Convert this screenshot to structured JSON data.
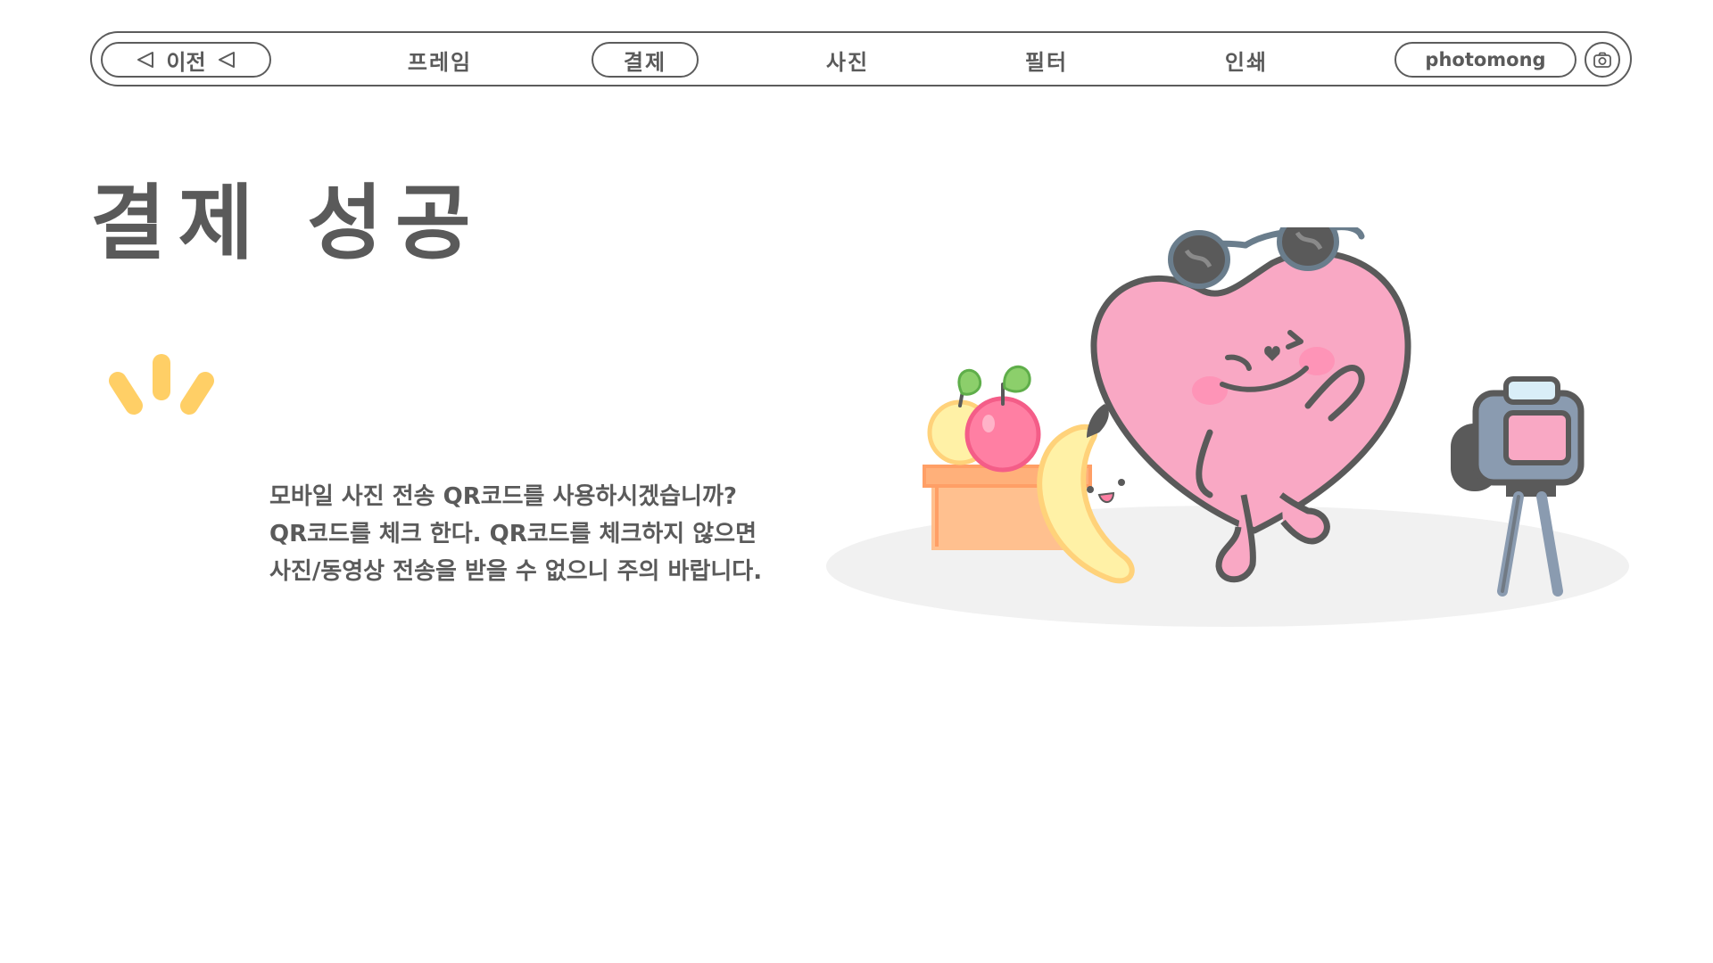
{
  "nav": {
    "back_label": "이전",
    "tabs": [
      {
        "label": "프레임",
        "active": false
      },
      {
        "label": "결제",
        "active": true
      },
      {
        "label": "사진",
        "active": false
      },
      {
        "label": "필터",
        "active": false
      },
      {
        "label": "인쇄",
        "active": false
      }
    ],
    "brand": "photomong",
    "camera_icon": "camera-icon"
  },
  "main": {
    "title": "결제 성공",
    "notice_lines": [
      "모바일 사진 전송 QR코드를 사용하시겠습니까?",
      "QR코드를 체크 한다. QR코드를 체크하지 않으면",
      "사진/동영상 전송을 받을 수 없으니 주의 바랍니다."
    ]
  },
  "colors": {
    "text": "#5a5a5a",
    "border": "#5c5c5c",
    "sparkle": "#ffcf66",
    "heart_pink": "#f9a8c4",
    "banana_yellow": "#fff1a6",
    "box_orange": "#ffc08f",
    "floor_shadow": "#f1f1f1"
  }
}
